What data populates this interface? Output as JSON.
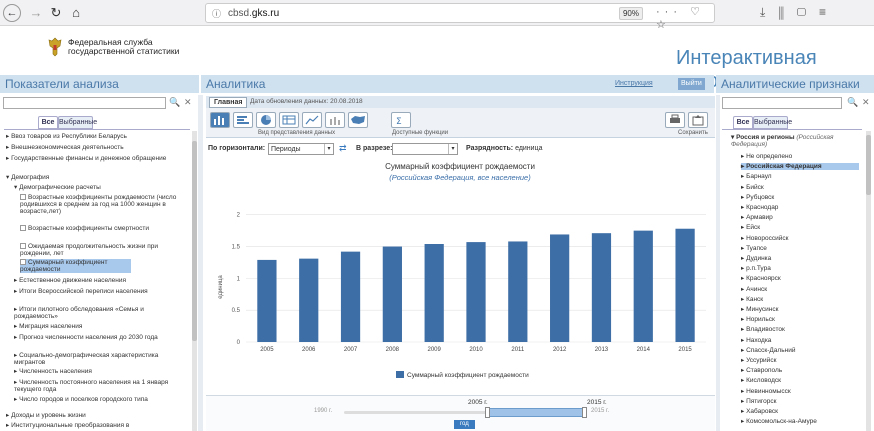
{
  "browser": {
    "back_icon": "arrow-left",
    "url_prefix": "cbsd.",
    "url_domain": "gks.ru",
    "zoom": "90%",
    "more": "···"
  },
  "header": {
    "org_line1": "Федеральная служба",
    "org_line2": "государственной статистики",
    "vitrina": "Интерактивная витрина"
  },
  "left": {
    "title": "Показатели анализа",
    "tab_all": "Все",
    "tab_fav": "Выбранные",
    "items": [
      "▸ Ввоз товаров из Республики Беларусь",
      "▸ Внешнеэкономическая деятельность",
      "▸ Государственные финансы и денежное обращение",
      "▾ Демография",
      "▾ Демографические расчеты",
      "Возрастные коэффициенты рождаемости (число родившихся в среднем за год на 1000 женщин в возрасте,лет)",
      "Возрастные коэффициенты смертности",
      "Ожидаемая продолжительность жизни при рождении, лет",
      "Суммарный коэффициент рождаемости",
      "▸ Естественное движение населения",
      "▸ Итоги Всероссийской переписи населения",
      "▸ Итоги пилотного обследования «Семья и рождаемость»",
      "▸ Миграция населения",
      "▸ Прогноз численности населения до 2030 года",
      "▸ Социально-демографическая характеристика мигрантов",
      "▸ Численность населения",
      "▸ Численность постоянного населения на 1 января текущего года",
      "▸ Число городов и поселков городского типа",
      "▸ Доходы и уровень жизни",
      "▸ Институциональные преобразования в"
    ]
  },
  "center": {
    "title": "Аналитика",
    "link_help": "Инструкция",
    "link_exit": "Выйти",
    "tab_main": "Главная",
    "update_date": "Дата обновления данных: 20.08.2018",
    "view_caption": "Вид представления данных",
    "functions_caption": "Доступные функции",
    "save_caption": "Сохранить",
    "horiz_label": "По горизонтали:",
    "horiz_value": "Периоды",
    "section_label": "В разрезе:",
    "section_value": "",
    "rank_label": "Разрядность:",
    "rank_value": "единица",
    "slider_left": "1990 г.",
    "slider_from": "2005 г.",
    "slider_to": "2015 г.",
    "slider_right": "2015 г.",
    "slider_unit": "год"
  },
  "chart_data": {
    "type": "bar",
    "title": "Суммарный коэффициент рождаемости",
    "subtitle": "(Российская Федерация, все население)",
    "ylabel": "единица",
    "xlabel": "",
    "categories": [
      "2005",
      "2006",
      "2007",
      "2008",
      "2009",
      "2010",
      "2011",
      "2012",
      "2013",
      "2014",
      "2015"
    ],
    "values": [
      1.29,
      1.31,
      1.42,
      1.5,
      1.54,
      1.57,
      1.58,
      1.69,
      1.71,
      1.75,
      1.78
    ],
    "ylim": [
      0,
      2.2
    ],
    "yticks": [
      0,
      0.5,
      1,
      1.5,
      2
    ],
    "ytick_labels": [
      "0",
      "0.5",
      "1",
      "1.5",
      "2"
    ],
    "legend": "Суммарный коэффициент рождаемости",
    "legend_position": "bottom",
    "grid": true,
    "bar_color": "#3e6ea6"
  },
  "right": {
    "title": "Аналитические признаки",
    "tab_all": "Все",
    "tab_fav": "Выбранные",
    "root": "▾ Россия и регионы",
    "root_note": "(Российская Федерация)",
    "items": [
      "▸ Не определено",
      "▸ Российская Федерация",
      "▸ Барнаул",
      "▸ Бийск",
      "▸ Рубцовск",
      "▸ Краснодар",
      "▸ Армавир",
      "▸ Ейск",
      "▸ Новороссийск",
      "▸ Туапсе",
      "▸ Дудинка",
      "▸ р.п.Тура",
      "▸ Красноярск",
      "▸ Ачинск",
      "▸ Канск",
      "▸ Минусинск",
      "▸ Норильск",
      "▸ Владивосток",
      "▸ Находка",
      "▸ Спасск-Дальний",
      "▸ Уссурийск",
      "▸ Ставрополь",
      "▸ Кисловодск",
      "▸ Невинномысск",
      "▸ Пятигорск",
      "▸ Хабаровск",
      "▸ Комсомольск-на-Амуре"
    ]
  }
}
